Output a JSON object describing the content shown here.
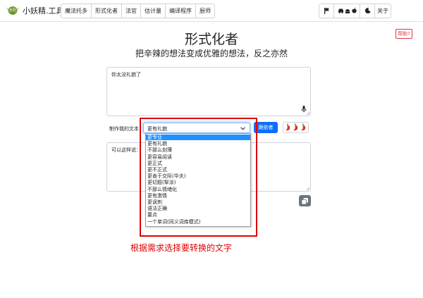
{
  "header": {
    "brand": "小妖精.工具",
    "tabs": [
      {
        "label": "魔法托多"
      },
      {
        "label": "形式化者"
      },
      {
        "label": "法官"
      },
      {
        "label": "估计量"
      },
      {
        "label": "编译程序"
      },
      {
        "label": "厨师"
      }
    ],
    "about_label": "关于"
  },
  "main": {
    "title": "形式化者",
    "subtitle": "把辛辣的想法变成优雅的想法，反之亦然",
    "help_label": "帮助?",
    "input_text": "你太没礼貌了",
    "output_text": "可以这样说：",
    "control_label": "制作我的文本",
    "selected_option": "更有礼貌",
    "go_label": "跟依者"
  },
  "dropdown": {
    "options": [
      {
        "label": "更专业",
        "selected": true
      },
      {
        "label": "更有礼貌",
        "selected": false
      },
      {
        "label": "不那么刻薄",
        "selected": false
      },
      {
        "label": "更容易阅读",
        "selected": false
      },
      {
        "label": "更正式",
        "selected": false
      },
      {
        "label": "更不正式",
        "selected": false
      },
      {
        "label": "更善于交际(华夫)",
        "selected": false
      },
      {
        "label": "更切题(掣涂)",
        "selected": false
      },
      {
        "label": "不那么情绪化",
        "selected": false
      },
      {
        "label": "更有激情",
        "selected": false
      },
      {
        "label": "更讽刺",
        "selected": false
      },
      {
        "label": "语法正确",
        "selected": false
      },
      {
        "label": "要点",
        "selected": false
      },
      {
        "label": "一个单词(同义词库模式)",
        "selected": false
      }
    ]
  },
  "annotation": {
    "caption": "根据需求选择要转换的文字",
    "color": "#e00000"
  },
  "colors": {
    "primary": "#0d6efd",
    "highlight": "#1e90ff",
    "danger": "#dc3545",
    "secondary": "#6c757d"
  },
  "icons": [
    "goblin-logo-icon",
    "flag-icon",
    "car-icon",
    "android-icon",
    "apple-icon",
    "moon-icon",
    "microphone-icon",
    "chevron-down-icon",
    "chili-pepper-icon",
    "copy-icon"
  ]
}
